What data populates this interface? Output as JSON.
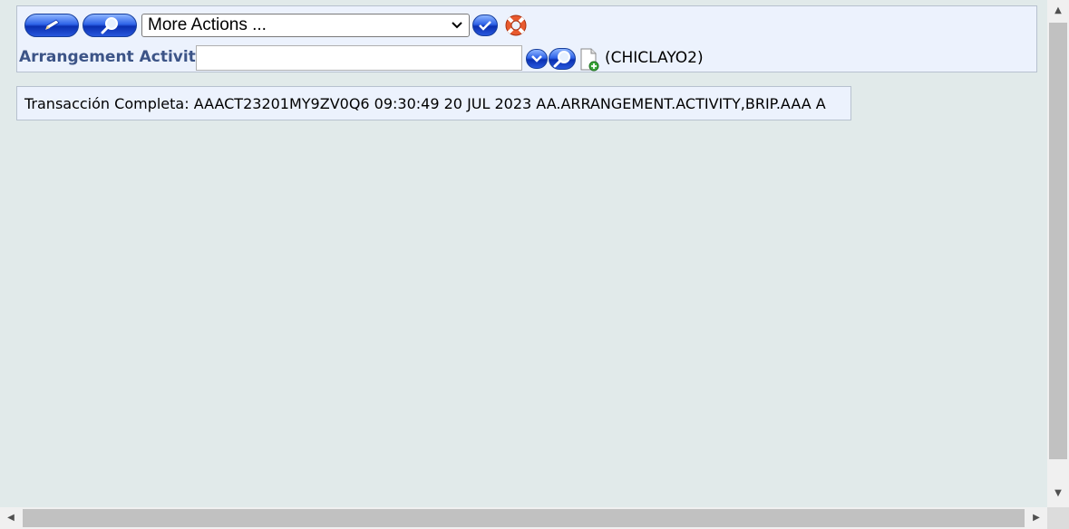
{
  "toolbar": {
    "edit_icon": "pencil-icon",
    "view_icon": "magnifier-icon",
    "actions_select_value": "More Actions ...",
    "commit_icon": "checkmark-icon",
    "help_icon": "lifebuoy-icon"
  },
  "transaction": {
    "field_label": "Arrangement Activity",
    "field_value": "",
    "dropdown_icon": "chevron-down-icon",
    "search_icon": "magnifier-icon",
    "new_icon": "new-document-icon",
    "company": "(CHICLAYO2)"
  },
  "message": {
    "text": "Transacción Completa: AAACT23201MY9ZV0Q6 09:30:49 20 JUL 2023 AA.ARRANGEMENT.ACTIVITY,BRIP.AAA A"
  },
  "colors": {
    "page_bg": "#e1eaea",
    "panel_bg": "#ecf2fd",
    "label_color": "#3c5487",
    "button_blue": "#2e63e8"
  }
}
